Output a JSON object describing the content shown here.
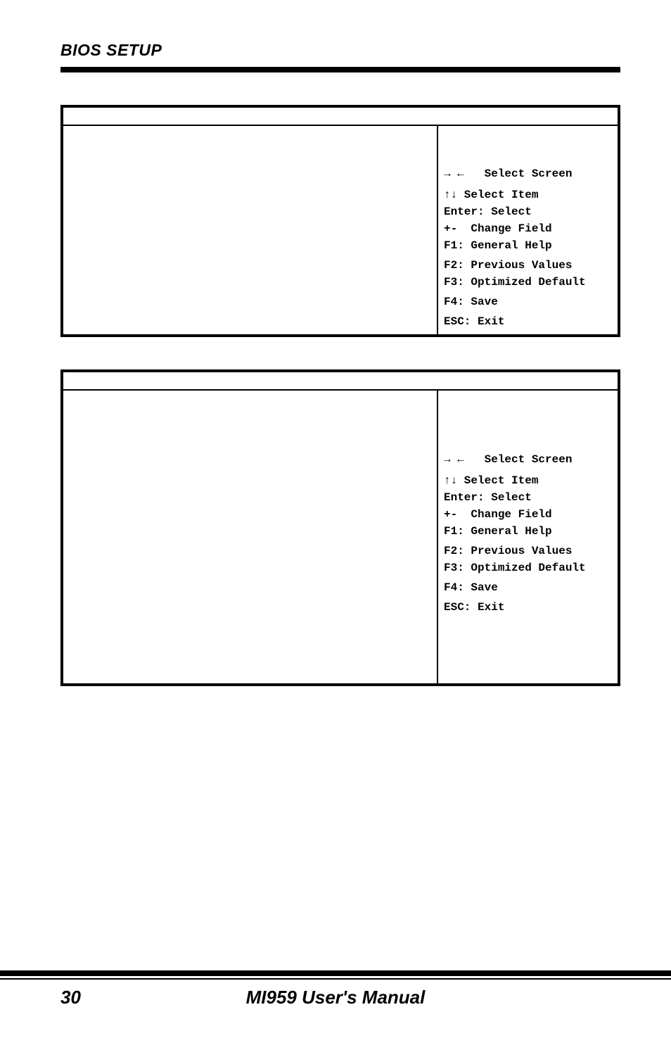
{
  "header": {
    "title": "BIOS SETUP"
  },
  "box_a": {
    "help": {
      "select_screen": "→ ←   Select Screen",
      "select_item": "↑↓ Select Item",
      "enter": "Enter: Select",
      "change_field": "+-  Change Field",
      "general_help": "F1: General Help",
      "prev_values": "F2: Previous Values",
      "opt_default": "F3: Optimized Default",
      "save": "F4: Save",
      "exit": "ESC: Exit"
    }
  },
  "box_b": {
    "help": {
      "select_screen": "→ ←   Select Screen",
      "select_item": "↑↓ Select Item",
      "enter": "Enter: Select",
      "change_field": "+-  Change Field",
      "general_help": "F1: General Help",
      "prev_values": "F2: Previous Values",
      "opt_default": "F3: Optimized Default",
      "save": "F4: Save",
      "exit": "ESC: Exit"
    }
  },
  "footer": {
    "page": "30",
    "title": "MI959 User's Manual"
  }
}
